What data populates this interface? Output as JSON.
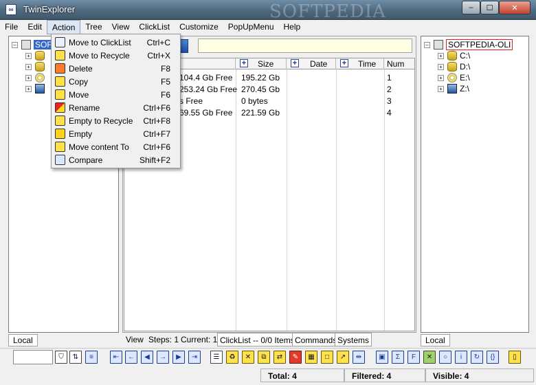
{
  "window": {
    "title": "TwinExplorer",
    "watermark": "SOFTPEDIA",
    "controls": {
      "minimize": "–",
      "maximize": "☐",
      "close": "✕"
    },
    "icon": "twinexplorer-icon"
  },
  "menubar": {
    "items": [
      "File",
      "Edit",
      "Action",
      "Tree",
      "View",
      "ClickList",
      "Customize",
      "PopUpMenu",
      "Help"
    ],
    "active": "Action"
  },
  "action_menu": [
    {
      "label": "Move to ClickList",
      "shortcut": "Ctrl+C",
      "icon": "clicklist-icon"
    },
    {
      "label": "Move to Recycle",
      "shortcut": "Ctrl+X",
      "icon": "recycle-icon"
    },
    {
      "label": "Delete",
      "shortcut": "F8",
      "icon": "delete-icon"
    },
    {
      "label": "Copy",
      "shortcut": "F5",
      "icon": "copy-icon"
    },
    {
      "label": "Move",
      "shortcut": "F6",
      "icon": "move-icon"
    },
    {
      "label": "Rename",
      "shortcut": "Ctrl+F6",
      "icon": "rename-icon"
    },
    {
      "label": "Empty to Recycle",
      "shortcut": "Ctrl+F8",
      "icon": "empty-recycle-icon"
    },
    {
      "label": "Empty",
      "shortcut": "Ctrl+F7",
      "icon": "empty-icon"
    },
    {
      "label": "Move content To",
      "shortcut": "Ctrl+F6",
      "icon": "move-content-icon"
    },
    {
      "label": "Compare",
      "shortcut": "Shift+F2",
      "icon": "compare-icon"
    }
  ],
  "left_tree": {
    "root": "SOF",
    "tab": "Local"
  },
  "right_tree": {
    "root": "SOFTPEDIA-OLI",
    "drives": [
      "C:\\",
      "D:\\",
      "E:\\",
      "Z:\\"
    ],
    "tab": "Local"
  },
  "file_list": {
    "columns": {
      "size": "Size",
      "date": "Date",
      "time": "Time",
      "num": "Num"
    },
    "rows": [
      {
        "free": "104.4 Gb Free",
        "size": "195.22 Gb",
        "num": "1"
      },
      {
        "free": "253.24 Gb Free",
        "size": "270.45 Gb",
        "num": "2"
      },
      {
        "free": "s Free",
        "size": "0 bytes",
        "num": "3"
      },
      {
        "free": "69.55 Gb Free",
        "size": "221.59 Gb",
        "num": "4"
      }
    ]
  },
  "center_tabs": {
    "view": "View",
    "steps": "Steps: 1",
    "current": "Current: 1",
    "clicklist": "ClickList -- 0/0 Items",
    "commands": "Commands",
    "systems": "Systems"
  },
  "status": {
    "total": "Total: 4",
    "filtered": "Filtered: 4",
    "visible": "Visible: 4"
  }
}
